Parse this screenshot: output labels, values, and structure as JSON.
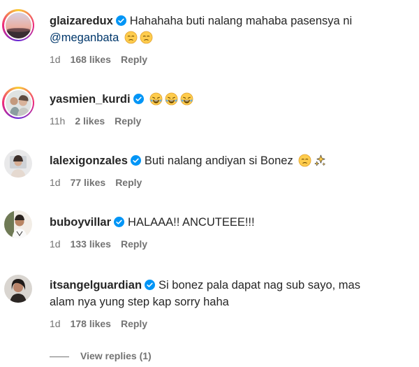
{
  "comments": [
    {
      "username": "glaizaredux",
      "text": "Hahahaha buti nalang mahaba pasensya ni",
      "mention": "@meganbata",
      "emojis": [
        "pensive-face",
        "pensive-face"
      ],
      "time": "1d",
      "likes": "168 likes",
      "reply": "Reply"
    },
    {
      "username": "yasmien_kurdi",
      "text": "",
      "emojis": [
        "tears-of-joy-face",
        "tears-of-joy-face",
        "tears-of-joy-face"
      ],
      "time": "11h",
      "likes": "2 likes",
      "reply": "Reply"
    },
    {
      "username": "lalexigonzales",
      "text": "Buti nalang andiyan si Bonez",
      "emojis": [
        "pensive-face",
        "sparkles"
      ],
      "time": "1d",
      "likes": "77 likes",
      "reply": "Reply"
    },
    {
      "username": "buboyvillar",
      "text": "HALAAA!! ANCUTEEE!!!",
      "emojis": [],
      "time": "1d",
      "likes": "133 likes",
      "reply": "Reply"
    },
    {
      "username": "itsangelguardian",
      "text": "Si bonez pala dapat nag sub sayo, mas",
      "text_line2": "alam nya yung step kap sorry haha",
      "emojis": [],
      "time": "1d",
      "likes": "178 likes",
      "reply": "Reply"
    }
  ],
  "view_replies": "View replies (1)",
  "colors": {
    "text": "#262626",
    "secondary": "#737373",
    "mention": "#00376b",
    "verified": "#0095f6"
  }
}
